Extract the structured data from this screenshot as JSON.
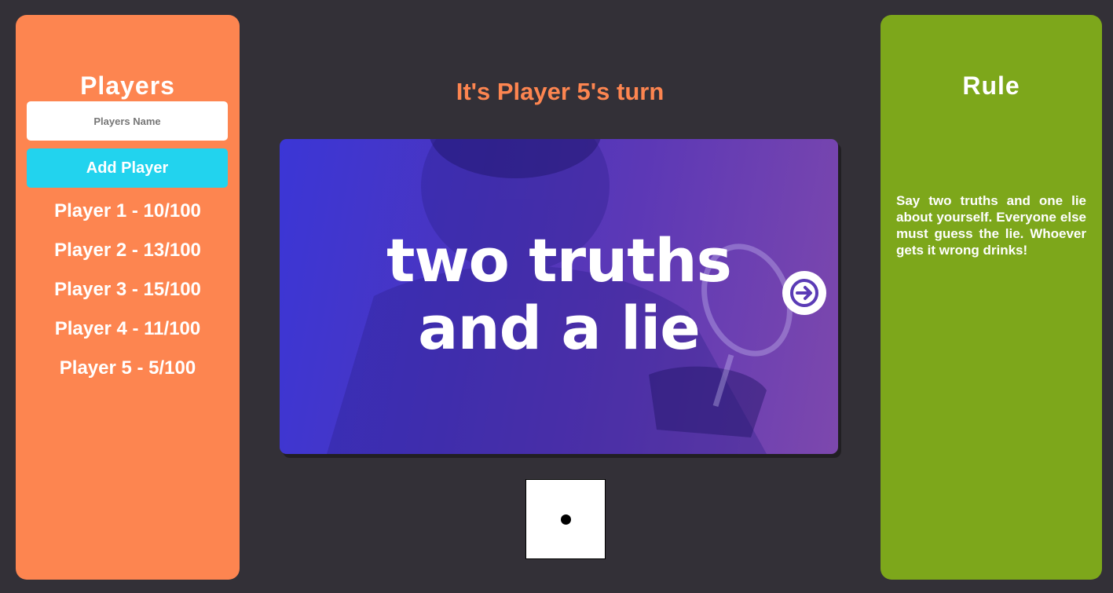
{
  "players_panel": {
    "title": "Players",
    "name_input": {
      "placeholder": "Players Name",
      "value": ""
    },
    "add_button_label": "Add Player",
    "players": [
      {
        "label": "Player 1 - 10/100"
      },
      {
        "label": "Player 2 - 13/100"
      },
      {
        "label": "Player 3 - 15/100"
      },
      {
        "label": "Player 4 - 11/100"
      },
      {
        "label": "Player 5 - 5/100"
      }
    ]
  },
  "game": {
    "turn_text": "It's Player 5's turn",
    "card": {
      "title_line1": "two truths",
      "title_line2": "and a lie",
      "next_icon": "arrow-right-circle-icon"
    },
    "die": {
      "value": 1
    }
  },
  "rule_panel": {
    "title": "Rule",
    "text": "Say two truths and one lie about yourself. Everyone else must guess the lie. Whoever gets it wrong drinks!"
  },
  "colors": {
    "background": "#333037",
    "players_panel": "#fd8550",
    "add_button": "#22d3ee",
    "rule_panel": "#7da71b",
    "turn_text": "#fd8550"
  }
}
